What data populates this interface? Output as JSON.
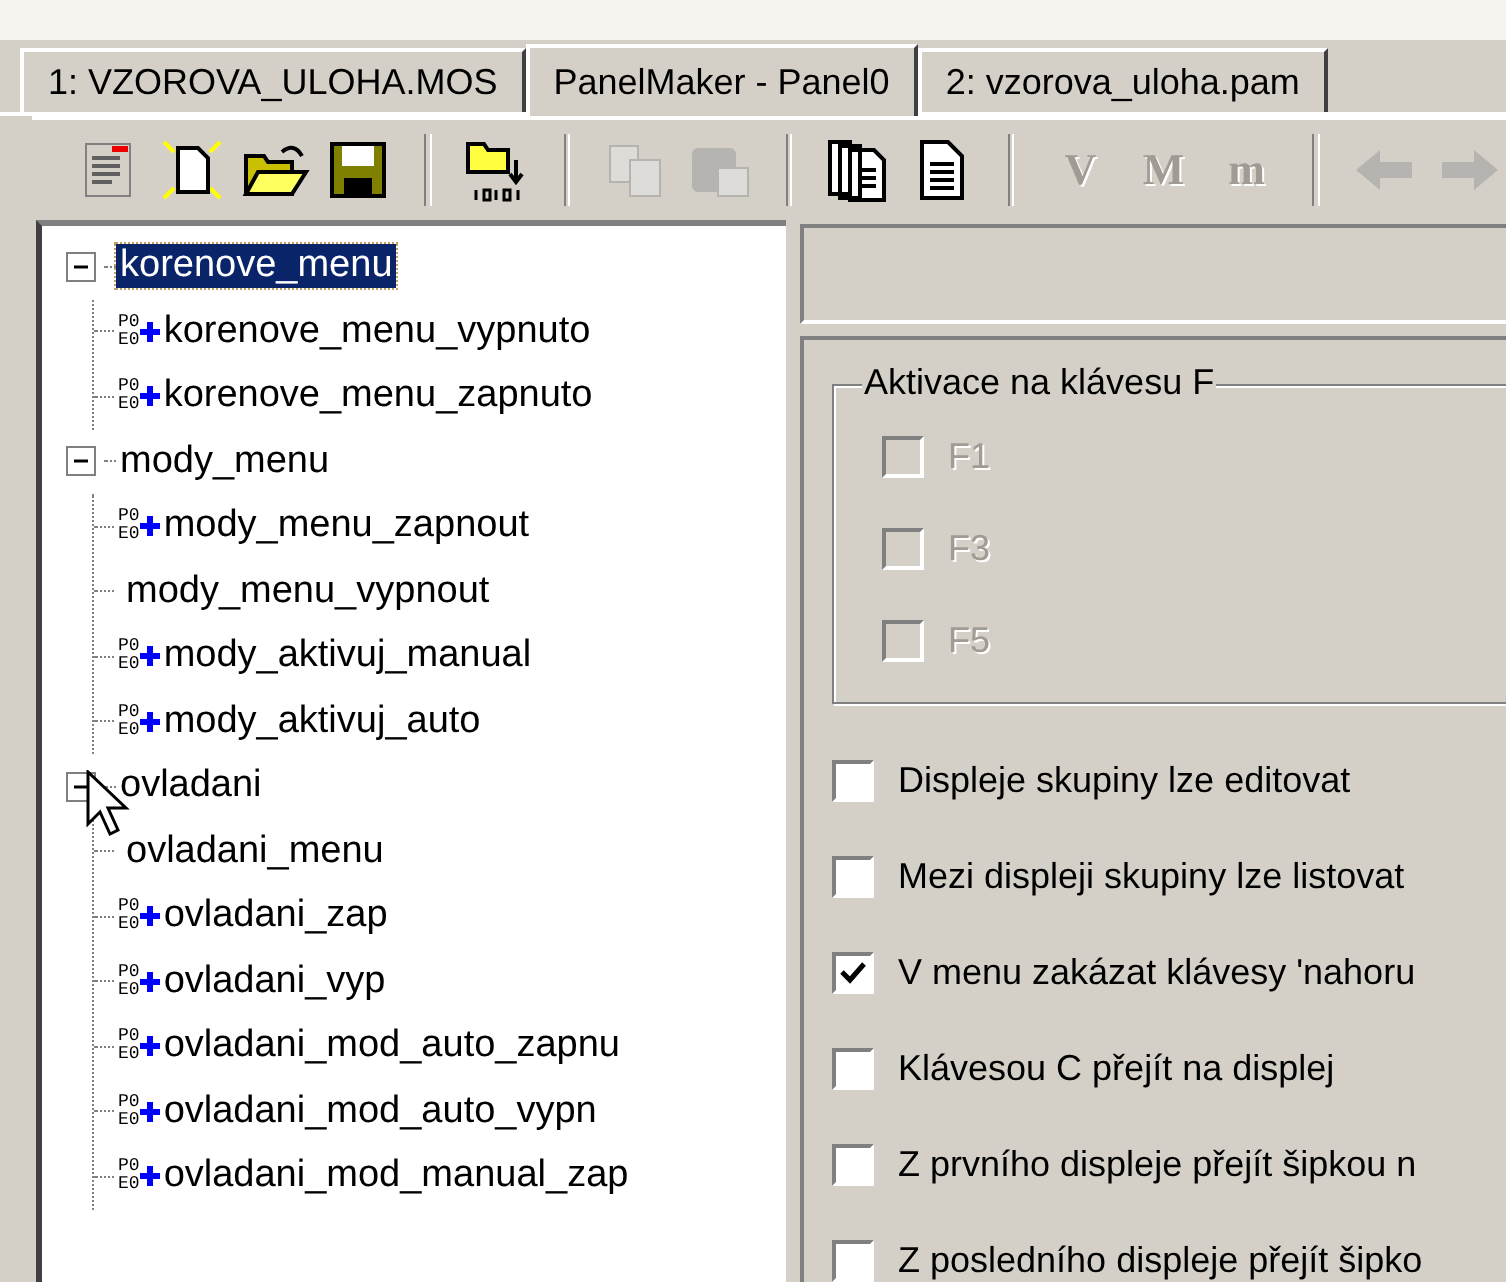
{
  "tabs": [
    {
      "label": "1: VZOROVA_ULOHA.MOS",
      "selected": false
    },
    {
      "label": "PanelMaker - Panel0",
      "selected": true
    },
    {
      "label": "2: vzorova_uloha.pam",
      "selected": false
    }
  ],
  "toolbar": [
    [
      {
        "kind": "properties",
        "disabled": false
      },
      {
        "kind": "new",
        "disabled": false
      },
      {
        "kind": "open",
        "disabled": false
      },
      {
        "kind": "save",
        "disabled": false
      }
    ],
    [
      {
        "kind": "export",
        "disabled": false
      }
    ],
    [
      {
        "kind": "copy",
        "disabled": true
      },
      {
        "kind": "paste",
        "disabled": true
      }
    ],
    [
      {
        "kind": "pages",
        "disabled": false
      },
      {
        "kind": "document",
        "disabled": false
      }
    ],
    [
      {
        "kind": "letter",
        "label": "V",
        "disabled": true
      },
      {
        "kind": "letter",
        "label": "M",
        "disabled": true
      },
      {
        "kind": "letter",
        "label": "m",
        "disabled": true
      }
    ],
    [
      {
        "kind": "back",
        "disabled": true
      },
      {
        "kind": "forward",
        "disabled": true
      }
    ]
  ],
  "tree": [
    {
      "label": "korenove_menu",
      "expanded": true,
      "selected": true,
      "children": [
        {
          "label": "korenove_menu_vypnuto",
          "kind": "event",
          "badge": [
            "P0",
            "E0"
          ],
          "selected": false
        },
        {
          "label": "korenove_menu_zapnuto",
          "kind": "event",
          "badge": [
            "P0",
            "E0"
          ],
          "selected": false
        }
      ]
    },
    {
      "label": "mody_menu",
      "expanded": true,
      "selected": false,
      "children": [
        {
          "label": "mody_menu_zapnout",
          "kind": "event",
          "badge": [
            "P0",
            "E0"
          ],
          "selected": false
        },
        {
          "label": "mody_menu_vypnout",
          "kind": "plain",
          "selected": false
        },
        {
          "label": "mody_aktivuj_manual",
          "kind": "event",
          "badge": [
            "P0",
            "E0"
          ],
          "selected": false
        },
        {
          "label": "mody_aktivuj_auto",
          "kind": "event",
          "badge": [
            "P0",
            "E0"
          ],
          "selected": false
        }
      ]
    },
    {
      "label": "ovladani",
      "expanded": true,
      "selected": false,
      "children": [
        {
          "label": "ovladani_menu",
          "kind": "plain",
          "selected": false
        },
        {
          "label": "ovladani_zap",
          "kind": "event",
          "badge": [
            "P0",
            "E0"
          ],
          "selected": false
        },
        {
          "label": "ovladani_vyp",
          "kind": "event",
          "badge": [
            "P0",
            "E0"
          ],
          "selected": false
        },
        {
          "label": "ovladani_mod_auto_zapnu",
          "kind": "event",
          "badge": [
            "P0",
            "E0"
          ],
          "selected": false
        },
        {
          "label": "ovladani_mod_auto_vypn",
          "kind": "event",
          "badge": [
            "P0",
            "E0"
          ],
          "selected": false
        },
        {
          "label": "ovladani_mod_manual_zap",
          "kind": "event",
          "badge": [
            "P0",
            "E0"
          ],
          "selected": false
        }
      ]
    }
  ],
  "key_group": {
    "title": "Aktivace na klávesu F",
    "options": [
      {
        "label": "F1",
        "checked": false,
        "disabled": true
      },
      {
        "label": "F3",
        "checked": false,
        "disabled": true
      },
      {
        "label": "F5",
        "checked": false,
        "disabled": true
      }
    ]
  },
  "options": [
    {
      "label": "Displeje skupiny lze editovat",
      "checked": false
    },
    {
      "label": "Mezi displeji skupiny lze listovat",
      "checked": false
    },
    {
      "label": "V menu zakázat klávesy 'nahoru",
      "checked": true
    },
    {
      "label": "Klávesou C přejít na displej",
      "checked": false
    },
    {
      "label": "Z prvního displeje přejít šipkou n",
      "checked": false
    },
    {
      "label": "Z posledního displeje přejít šipko",
      "checked": false
    }
  ]
}
